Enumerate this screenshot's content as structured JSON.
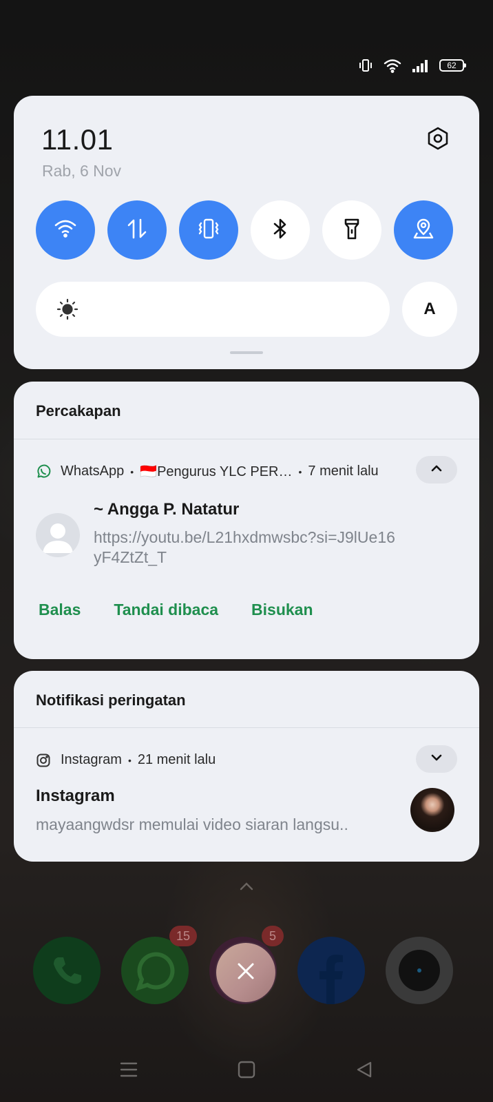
{
  "status_bar": {
    "battery_level": "62",
    "icons": [
      "vibrate-icon",
      "wifi-icon",
      "signal-icon",
      "battery-icon"
    ]
  },
  "quick_settings": {
    "time": "11.01",
    "date": "Rab, 6 Nov",
    "auto_brightness_label": "A",
    "accent_color": "#3d84f5",
    "tiles": [
      {
        "name": "wifi",
        "icon": "wifi-icon",
        "on": true
      },
      {
        "name": "mobile-data",
        "icon": "data-arrows-icon",
        "on": true
      },
      {
        "name": "vibrate",
        "icon": "vibrate-icon",
        "on": true
      },
      {
        "name": "bluetooth",
        "icon": "bluetooth-icon",
        "on": false
      },
      {
        "name": "flashlight",
        "icon": "flashlight-icon",
        "on": false
      },
      {
        "name": "location",
        "icon": "location-icon",
        "on": true
      }
    ]
  },
  "conversation_section": {
    "title": "Percakapan",
    "notification": {
      "app": "WhatsApp",
      "group": "🇮🇩Pengurus YLC PER…",
      "time": "7 menit lalu",
      "sender": "~ Angga P. Natatur",
      "message": "https://youtu.be/L21hxdmwsbc?si=J9lUe16yF4ZtZt_T",
      "actions": [
        "Balas",
        "Tandai dibaca",
        "Bisukan"
      ],
      "action_color": "#1f8f4e"
    }
  },
  "alert_section": {
    "title": "Notifikasi peringatan",
    "notification": {
      "app": "Instagram",
      "time": "21 menit lalu",
      "title": "Instagram",
      "text": "mayaangwdsr memulai video siaran langsu.."
    }
  },
  "dock": {
    "apps": [
      "phone",
      "whatsapp",
      "instagram",
      "facebook",
      "camera"
    ],
    "badges": {
      "whatsapp": "15",
      "instagram": "5"
    }
  }
}
